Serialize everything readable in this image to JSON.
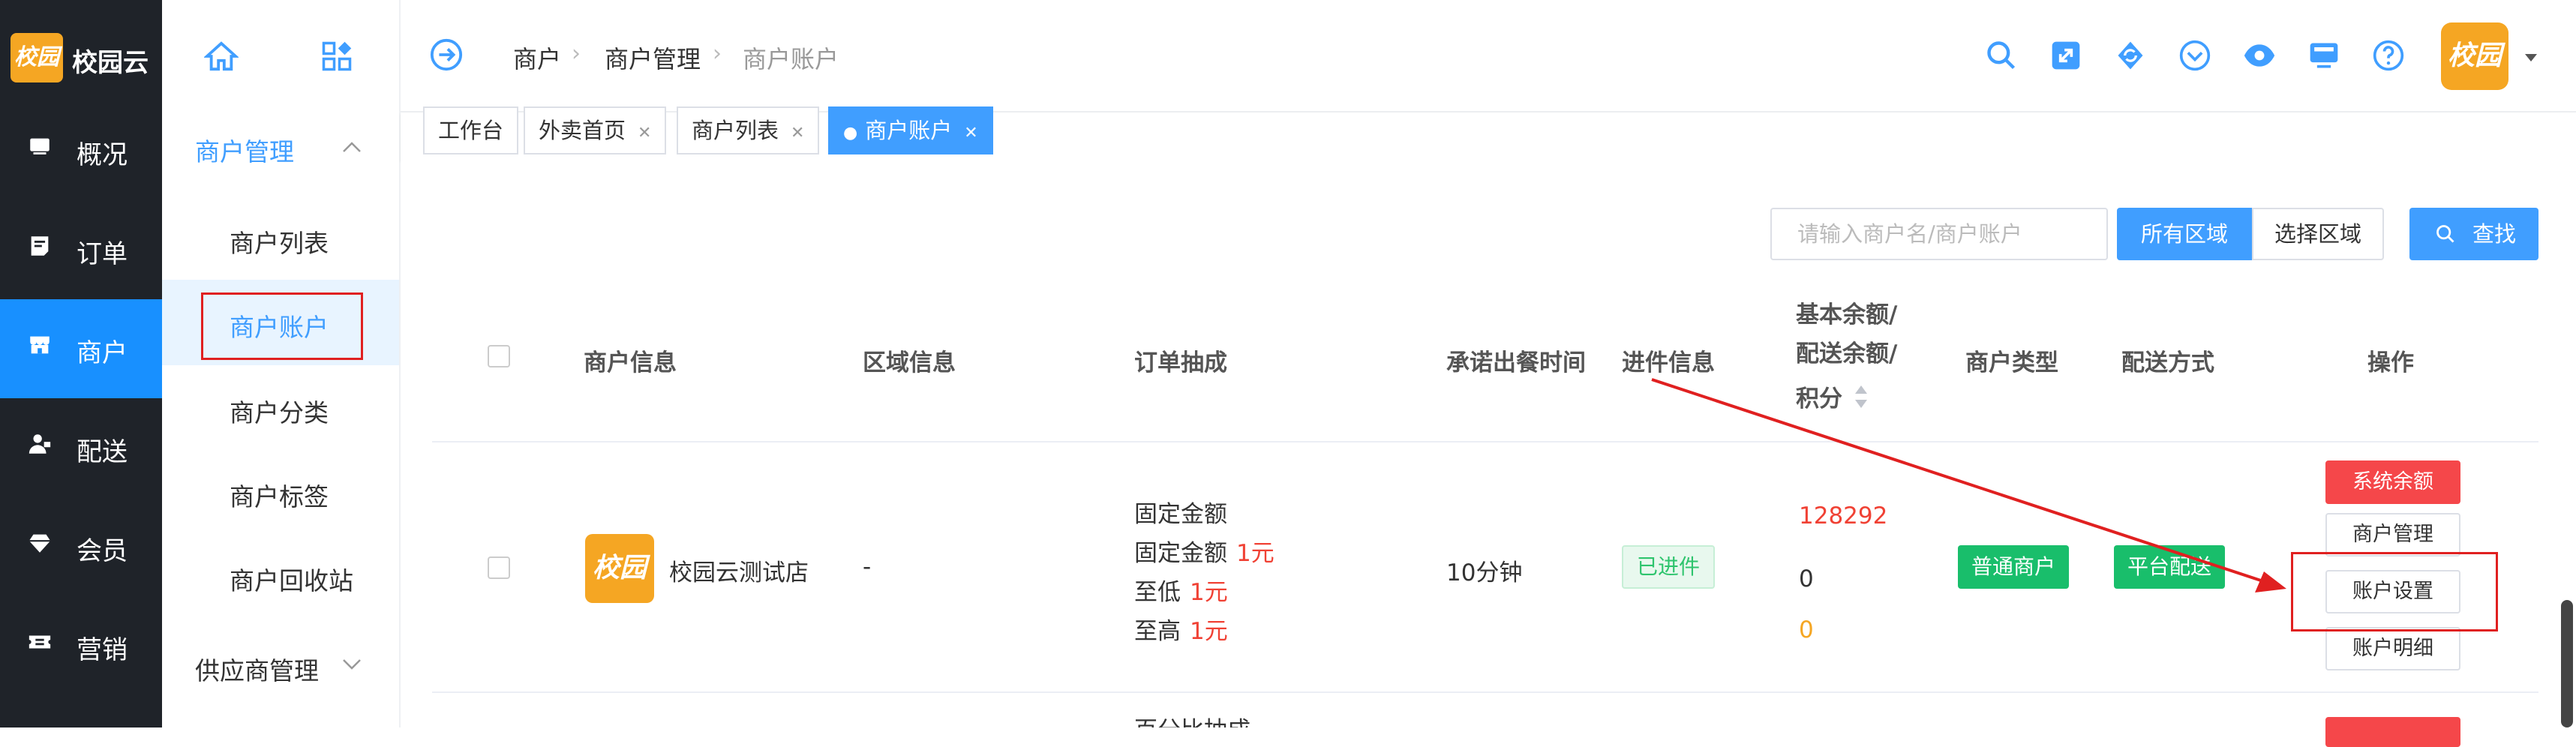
{
  "brand": {
    "name": "校园云",
    "logo_text": "校园"
  },
  "left_nav": [
    {
      "label": "概况",
      "icon": "monitor-icon"
    },
    {
      "label": "订单",
      "icon": "receipt-icon"
    },
    {
      "label": "商户",
      "icon": "store-icon",
      "active": true
    },
    {
      "label": "配送",
      "icon": "courier-icon"
    },
    {
      "label": "会员",
      "icon": "diamond-icon"
    },
    {
      "label": "营销",
      "icon": "ticket-icon"
    }
  ],
  "sub_nav": {
    "group_label": "商户管理",
    "items": [
      "商户列表",
      "商户账户",
      "商户分类",
      "商户标签",
      "商户回收站"
    ],
    "active": "商户账户",
    "group2_label": "供应商管理"
  },
  "breadcrumb": [
    "商户",
    "商户管理",
    "商户账户"
  ],
  "header_icons": [
    "search-icon",
    "fullscreen-icon",
    "refresh-icon",
    "chevron-circle-icon",
    "eye-icon",
    "monitor-icon",
    "help-icon"
  ],
  "tabs": [
    {
      "label": "工作台",
      "closable": false
    },
    {
      "label": "外卖首页",
      "closable": true
    },
    {
      "label": "商户列表",
      "closable": true
    },
    {
      "label": "商户账户",
      "closable": true,
      "active": true
    }
  ],
  "toolbar": {
    "search_placeholder": "请输入商户名/商户账户",
    "region_all": "所有区域",
    "region_select": "选择区域",
    "search_button": "查找"
  },
  "table": {
    "headers": {
      "merchant_info": "商户信息",
      "region_info": "区域信息",
      "order_commission": "订单抽成",
      "promised_time": "承诺出餐时间",
      "onboarding_info": "进件信息",
      "balance_line1": "基本余额/",
      "balance_line2": "配送余额/",
      "balance_line3": "积分",
      "merchant_type": "商户类型",
      "delivery_mode": "配送方式",
      "actions": "操作"
    },
    "rows": [
      {
        "logo_text": "校园",
        "name": "校园云测试店",
        "region": "-",
        "commission_title": "固定金额",
        "commission_fixed_label": "固定金额",
        "commission_fixed_value": "1元",
        "commission_min_label": "至低",
        "commission_min_value": "1元",
        "commission_max_label": "至高",
        "commission_max_value": "1元",
        "promised_time": "10分钟",
        "onboarding_status": "已进件",
        "basic_balance": "128292",
        "delivery_balance": "0",
        "points": "0",
        "merchant_type": "普通商户",
        "delivery_mode": "平台配送",
        "actions": [
          "系统余额",
          "商户管理",
          "账户设置",
          "账户明细"
        ]
      }
    ],
    "next_row_partial": "百分比抽成"
  },
  "colors": {
    "primary": "#409eff",
    "sidebar_dark": "#1f2329",
    "sidebar_active": "#1890ff",
    "danger": "#f5474a",
    "success": "#19be6b",
    "annotation_red": "#e02020"
  }
}
